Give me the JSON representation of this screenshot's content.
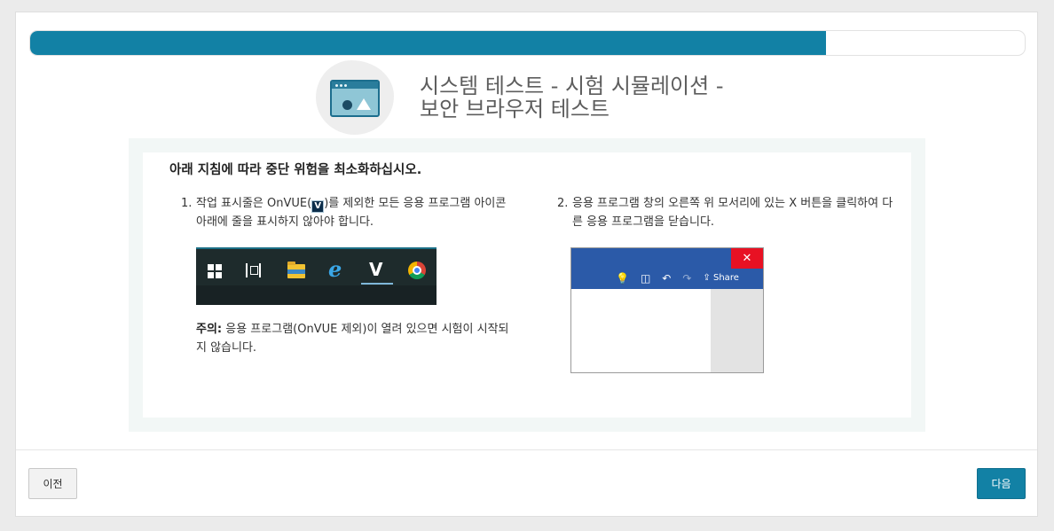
{
  "progress": {
    "fraction": 0.8
  },
  "header": {
    "title_line1": "시스템 테스트 - 시험 시뮬레이션 -",
    "title_line2": "보안 브라우저 테스트",
    "icon": "browser-window-icon"
  },
  "instructions": {
    "heading": "아래 지침에 따라 중단 위험을 최소화하십시오.",
    "step1": {
      "number": "1.",
      "text_before": "작업 표시줄은 OnVUE(",
      "inline_icon": "V",
      "text_after": ")를 제외한 모든 응용 프로그램 아이콘 아래에 줄을 표시하지 않아야 합니다."
    },
    "taskbar_icons": [
      "windows-start-icon",
      "task-view-icon",
      "file-explorer-icon",
      "internet-explorer-icon",
      "onvue-icon",
      "chrome-icon"
    ],
    "taskbar_glyphs": {
      "ie": "e",
      "onvue": "V"
    },
    "note": {
      "label": "주의:",
      "text": " 응용 프로그램(OnVUE 제외)이 열려 있으면 시험이 시작되지 않습니다."
    },
    "step2": {
      "number": "2.",
      "text": "응용 프로그램 창의 오른쪽 위 모서리에 있는 X 버튼을 클릭하여 다른 응용 프로그램을 닫습니다."
    },
    "office_window": {
      "close_glyph": "✕",
      "share_label": "Share",
      "toolbar_glyphs": [
        "💡",
        "◫",
        "↶",
        "↷",
        "⇪"
      ],
      "accent": "#2b5aa8",
      "close_color": "#e81123"
    }
  },
  "footer": {
    "prev_label": "이전",
    "next_label": "다음"
  },
  "colors": {
    "accent": "#1281a5",
    "panel_bg": "#f2f7f6"
  }
}
